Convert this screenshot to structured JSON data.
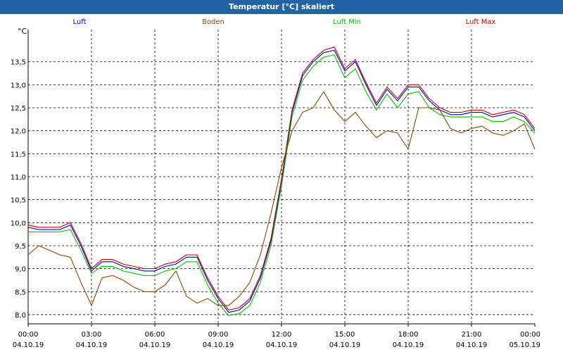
{
  "window": {
    "title": "Temperatur [°C] skaliert"
  },
  "chart_data": {
    "type": "line",
    "ylabel": "°C",
    "ylim": [
      7.8,
      14.2
    ],
    "xlim_hours": [
      0,
      24
    ],
    "grid": true,
    "legend_placement": "top",
    "y_ticks": [
      "8,0",
      "8,5",
      "9,0",
      "9,5",
      "10,0",
      "10,5",
      "11,0",
      "11,5",
      "12,0",
      "12,5",
      "13,0",
      "13,5"
    ],
    "x_ticks": [
      {
        "time": "00:00",
        "date": "04.10.19"
      },
      {
        "time": "03:00",
        "date": "04.10.19"
      },
      {
        "time": "06:00",
        "date": "04.10.19"
      },
      {
        "time": "09:00",
        "date": "04.10.19"
      },
      {
        "time": "12:00",
        "date": "04.10.19"
      },
      {
        "time": "15:00",
        "date": "04.10.19"
      },
      {
        "time": "18:00",
        "date": "04.10.19"
      },
      {
        "time": "21:00",
        "date": "04.10.19"
      },
      {
        "time": "00:00",
        "date": "05.10.19"
      }
    ],
    "x": [
      0,
      0.5,
      1,
      1.5,
      2,
      2.5,
      3,
      3.5,
      4,
      4.5,
      5,
      5.5,
      6,
      6.5,
      7,
      7.5,
      8,
      8.5,
      9,
      9.5,
      10,
      10.5,
      11,
      11.5,
      12,
      12.5,
      13,
      13.5,
      14,
      14.5,
      15,
      15.5,
      16,
      16.5,
      17,
      17.5,
      18,
      18.5,
      19,
      19.5,
      20,
      20.5,
      21,
      21.5,
      22,
      22.5,
      23,
      23.5,
      24
    ],
    "series": [
      {
        "name": "Luft",
        "color": "#0000c0",
        "values": [
          9.9,
          9.85,
          9.85,
          9.85,
          9.95,
          9.5,
          8.95,
          9.15,
          9.15,
          9.05,
          9.0,
          8.95,
          8.95,
          9.05,
          9.1,
          9.25,
          9.25,
          8.75,
          8.35,
          8.05,
          8.1,
          8.3,
          8.8,
          9.6,
          10.9,
          12.4,
          13.2,
          13.5,
          13.7,
          13.75,
          13.3,
          13.5,
          13.0,
          12.55,
          12.9,
          12.65,
          12.95,
          12.95,
          12.65,
          12.45,
          12.35,
          12.35,
          12.4,
          12.4,
          12.3,
          12.35,
          12.4,
          12.3,
          12.0
        ]
      },
      {
        "name": "Boden",
        "color": "#8b4500",
        "values": [
          9.3,
          9.5,
          9.4,
          9.3,
          9.25,
          8.7,
          8.2,
          8.8,
          8.85,
          8.75,
          8.6,
          8.5,
          8.5,
          8.65,
          8.95,
          8.4,
          8.25,
          8.35,
          8.2,
          8.2,
          8.4,
          8.7,
          9.3,
          10.2,
          11.2,
          12.0,
          12.4,
          12.5,
          12.85,
          12.45,
          12.2,
          12.4,
          12.1,
          11.85,
          12.0,
          11.95,
          11.6,
          12.5,
          12.5,
          12.45,
          12.05,
          11.95,
          12.05,
          12.1,
          11.95,
          11.9,
          12.0,
          12.15,
          11.6
        ]
      },
      {
        "name": "Luft Min",
        "color": "#00c000",
        "values": [
          9.8,
          9.8,
          9.8,
          9.8,
          9.85,
          9.4,
          8.9,
          9.05,
          9.05,
          8.95,
          8.9,
          8.85,
          8.85,
          8.95,
          9.0,
          9.15,
          9.15,
          8.65,
          8.25,
          7.98,
          8.02,
          8.2,
          8.7,
          9.5,
          10.8,
          12.3,
          13.1,
          13.4,
          13.6,
          13.65,
          13.15,
          13.35,
          12.85,
          12.45,
          12.8,
          12.5,
          12.8,
          12.85,
          12.5,
          12.35,
          12.3,
          12.3,
          12.3,
          12.3,
          12.2,
          12.2,
          12.3,
          12.2,
          11.95
        ]
      },
      {
        "name": "Luft Max",
        "color": "#c00000",
        "values": [
          9.95,
          9.9,
          9.9,
          9.9,
          10.0,
          9.55,
          9.0,
          9.2,
          9.2,
          9.1,
          9.05,
          9.0,
          9.0,
          9.1,
          9.15,
          9.3,
          9.3,
          8.8,
          8.4,
          8.1,
          8.15,
          8.35,
          8.85,
          9.65,
          10.95,
          12.45,
          13.25,
          13.55,
          13.75,
          13.82,
          13.35,
          13.55,
          13.05,
          12.6,
          12.95,
          12.7,
          13.0,
          13.0,
          12.7,
          12.5,
          12.4,
          12.4,
          12.45,
          12.45,
          12.35,
          12.4,
          12.45,
          12.35,
          12.05
        ]
      }
    ]
  }
}
